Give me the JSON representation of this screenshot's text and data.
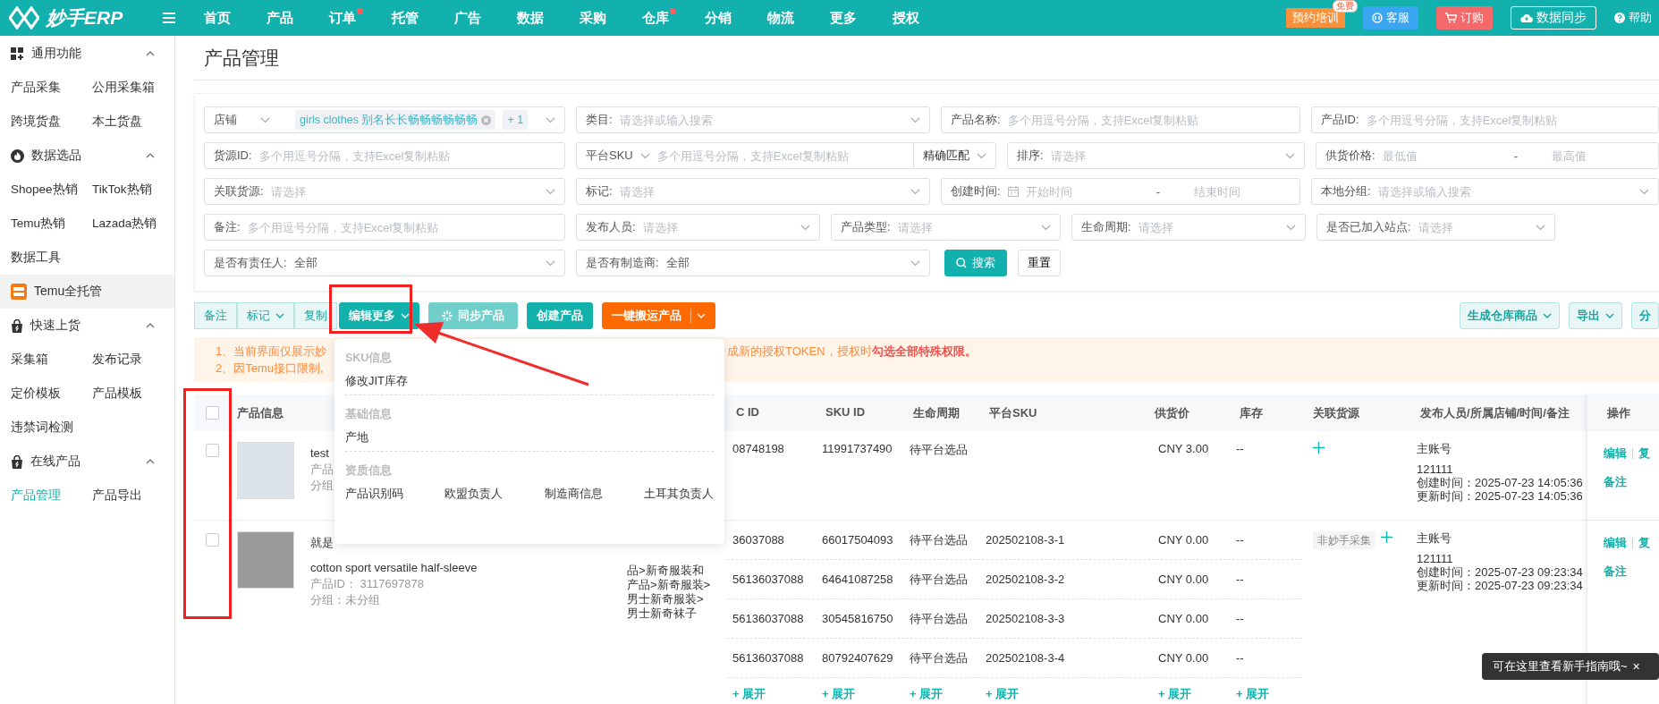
{
  "app": {
    "logo": "妙手ERP"
  },
  "nav": [
    {
      "label": "首页",
      "dot": false
    },
    {
      "label": "产品",
      "dot": false
    },
    {
      "label": "订单",
      "dot": true
    },
    {
      "label": "托管",
      "dot": false
    },
    {
      "label": "广告",
      "dot": false
    },
    {
      "label": "数据",
      "dot": false
    },
    {
      "label": "采购",
      "dot": false
    },
    {
      "label": "仓库",
      "dot": true
    },
    {
      "label": "分销",
      "dot": false
    },
    {
      "label": "物流",
      "dot": false
    },
    {
      "label": "更多",
      "dot": false
    },
    {
      "label": "授权",
      "dot": false
    }
  ],
  "top_actions": {
    "training": "预约培训",
    "badge": "免费",
    "service": "客服",
    "order": "订购",
    "sync": "数据同步",
    "help": "帮助"
  },
  "sidebar": [
    {
      "kind": "group",
      "label": "通用功能",
      "expanded": true,
      "items": [
        {
          "label": "产品采集",
          "selected": false
        },
        {
          "label": "公用采集箱",
          "selected": false
        },
        {
          "label": "跨境货盘",
          "selected": false
        },
        {
          "label": "本土货盘",
          "selected": false
        }
      ]
    },
    {
      "kind": "group",
      "label": "数据选品",
      "expanded": true,
      "items": [
        {
          "label": "Shopee热销",
          "selected": false
        },
        {
          "label": "TikTok热销",
          "selected": false
        },
        {
          "label": "Temu热销",
          "selected": false
        },
        {
          "label": "Lazada热销",
          "selected": false
        },
        {
          "label": "数据工具",
          "selected": false
        }
      ]
    },
    {
      "kind": "link",
      "label": "Temu全托管"
    },
    {
      "kind": "group",
      "label": "快速上货",
      "expanded": true,
      "items": [
        {
          "label": "采集箱",
          "selected": false
        },
        {
          "label": "发布记录",
          "selected": false
        },
        {
          "label": "定价模板",
          "selected": false
        },
        {
          "label": "产品模板",
          "selected": false
        },
        {
          "label": "违禁词检测",
          "selected": false
        }
      ]
    },
    {
      "kind": "group",
      "label": "在线产品",
      "expanded": true,
      "items": [
        {
          "label": "产品管理",
          "selected": true
        },
        {
          "label": "产品导出",
          "selected": false
        }
      ]
    }
  ],
  "page_title": "产品管理",
  "filters": [
    [
      {
        "kind": "shop",
        "label": "店铺",
        "tag": "girls clothes 别名长长畅畅畅畅畅畅",
        "more": "+ 1"
      },
      {
        "kind": "select",
        "label": "类目:",
        "placeholder": "请选择或输入搜索"
      },
      {
        "kind": "input",
        "label": "产品名称:",
        "placeholder": "多个用逗号分隔，支持Excel复制粘贴"
      },
      {
        "kind": "input",
        "label": "产品ID:",
        "placeholder": "多个用逗号分隔，支持Excel复制粘贴"
      }
    ],
    [
      {
        "kind": "input",
        "label": "货源ID:",
        "placeholder": "多个用逗号分隔，支持Excel复制粘贴"
      },
      {
        "kind": "sku",
        "label": "平台SKU",
        "placeholder": "多个用逗号分隔，支持Excel复制粘贴",
        "match": "精确匹配"
      },
      {
        "kind": "select",
        "label": "排序:",
        "placeholder": "请选择"
      },
      {
        "kind": "range",
        "label": "供货价格:",
        "from": {
          "placeholder": "最低值"
        },
        "separator": "-",
        "to": {
          "placeholder": "最高值"
        }
      }
    ],
    [
      {
        "kind": "select",
        "label": "关联货源:",
        "placeholder": "请选择"
      },
      {
        "kind": "select",
        "label": "标记:",
        "placeholder": "请选择"
      },
      {
        "kind": "date",
        "label": "创建时间:",
        "from": {
          "placeholder": "开始时间"
        },
        "separator": "-",
        "to": {
          "placeholder": "结束时间"
        }
      },
      {
        "kind": "select",
        "label": "本地分组:",
        "placeholder": "请选择或输入搜索"
      }
    ],
    [
      {
        "kind": "input",
        "label": "备注:",
        "placeholder": "多个用逗号分隔，支持Excel复制粘贴"
      },
      {
        "kind": "select",
        "label": "发布人员:",
        "placeholder": "请选择"
      },
      {
        "kind": "select",
        "label": "产品类型:",
        "placeholder": "请选择"
      },
      {
        "kind": "select",
        "label": "生命周期:",
        "placeholder": "请选择"
      },
      {
        "kind": "select",
        "label": "是否已加入站点:",
        "placeholder": "请选择"
      }
    ],
    [
      {
        "kind": "select",
        "label": "是否有责任人:",
        "value": "全部"
      },
      {
        "kind": "select",
        "label": "是否有制造商:",
        "value": "全部"
      },
      {
        "kind": "button",
        "label": "搜索",
        "primary": true
      },
      {
        "kind": "button",
        "label": "重置",
        "primary": false
      }
    ]
  ],
  "toolbar": {
    "left": [
      {
        "kind": "light",
        "label": "备注",
        "caret": false
      },
      {
        "kind": "light",
        "label": "标记",
        "caret": true
      },
      {
        "kind": "light",
        "label": "复制",
        "caret": false
      },
      {
        "kind": "primary",
        "label": "编辑更多",
        "caret": true
      },
      {
        "kind": "faded",
        "label": "同步产品",
        "caret": false
      },
      {
        "kind": "primary",
        "label": "创建产品",
        "caret": false
      },
      {
        "kind": "orange",
        "label": "一键搬运产品",
        "caret": true
      }
    ],
    "right": [
      {
        "kind": "outline",
        "label": "生成仓库商品",
        "caret": true
      },
      {
        "kind": "outline",
        "label": "导出",
        "caret": true
      },
      {
        "kind": "outline",
        "label": "分",
        "caret": false
      }
    ]
  },
  "notice": {
    "line1_left": "1、当前界面仅展示妙",
    "line1_right": "成新的授权TOKEN，授权时**勾选全部特殊权限。**",
    "line2": "2、因Temu接口限制,"
  },
  "dropdown": [
    {
      "title": "SKU信息",
      "items": [
        "修改JIT库存"
      ]
    },
    {
      "title": "基础信息",
      "items": [
        "产地"
      ]
    },
    {
      "title": "资质信息",
      "items": [
        "产品识别码",
        "欧盟负责人",
        "制造商信息",
        "土耳其负责人"
      ]
    }
  ],
  "table": {
    "select_all": {
      "checked": false
    },
    "columns": [
      "产品信息",
      "C ID",
      "SKU ID",
      "生命周期",
      "平台SKU",
      "供货价",
      "库存",
      "关联货源",
      "发布人员/所属店铺/时间/备注",
      "操作"
    ],
    "rows": [
      {
        "checked": false,
        "product": [
          "test",
          "产品",
          "分组"
        ],
        "skus": [
          {
            "skc": "08748198",
            "sku": "11991737490",
            "life": "待平台选品",
            "price": "CNY 3.00",
            "stock": "--"
          }
        ],
        "publisher": [
          "主账号",
          "121111",
          "创建时间：2025-07-23 14:05:36",
          "更新时间：2025-07-23 14:05:36"
        ],
        "actions": [
          "编辑",
          "复",
          "备注"
        ]
      },
      {
        "checked": false,
        "product": [
          "就是",
          "cotton sport versatile half-sleeve",
          "产品ID：  3117697878",
          "分组：未分组"
        ],
        "category": [
          "品>新奇服装和",
          "产品>新奇服装>",
          "男士新奇服装>",
          "男士新奇袜子"
        ],
        "skus": [
          {
            "skc": "36037088",
            "sku": "66017504093",
            "life": "待平台选品",
            "platform_sku": "202502108-3-1",
            "price": "CNY 0.00",
            "stock": "--"
          },
          {
            "skc": "56136037088",
            "sku": "64641087258",
            "life": "待平台选品",
            "platform_sku": "202502108-3-2",
            "price": "CNY 0.00",
            "stock": "--"
          },
          {
            "skc": "56136037088",
            "sku": "30545816750",
            "life": "待平台选品",
            "platform_sku": "202502108-3-3",
            "price": "CNY 0.00",
            "stock": "--"
          },
          {
            "skc": "56136037088",
            "sku": "80792407629",
            "life": "待平台选品",
            "platform_sku": "202502108-3-4",
            "price": "CNY 0.00",
            "stock": "--"
          }
        ],
        "source_tag": "非妙手采集",
        "expand": [
          "+ 展开",
          "+ 展开",
          "+ 展开",
          "+ 展开",
          "+ 展开",
          "+ 展开"
        ],
        "publisher": [
          "主账号",
          "121111",
          "创建时间：2025-07-23 09:23:34",
          "更新时间：2025-07-23 09:23:34"
        ],
        "actions": [
          "编辑",
          "复",
          "备注"
        ]
      }
    ]
  },
  "toast": {
    "text": "可在这里查看新手指南哦~",
    "close": "×"
  }
}
